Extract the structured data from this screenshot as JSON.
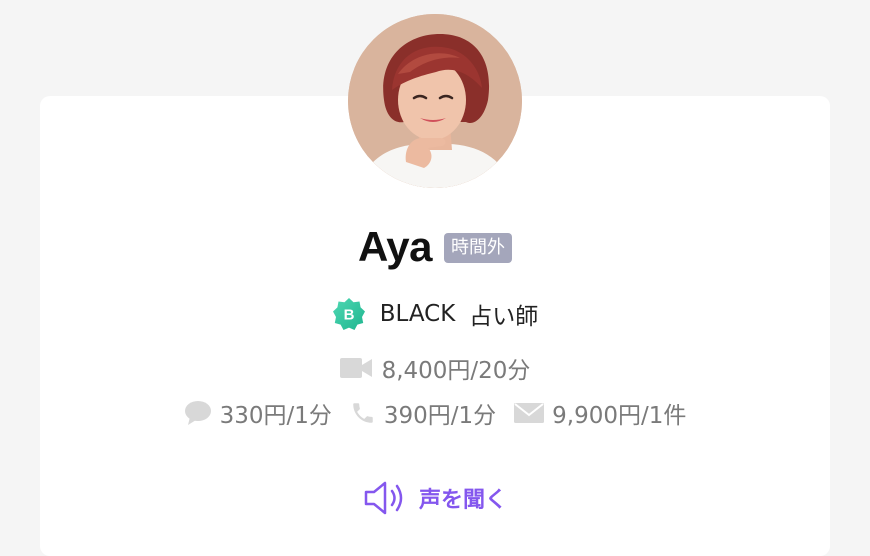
{
  "profile": {
    "name": "Aya",
    "status_badge": "時間外",
    "rank_letter": "B",
    "rank_label": "BLACK",
    "role_label": "占い師"
  },
  "prices": {
    "video": "8,400円/20分",
    "chat": "330円/1分",
    "phone": "390円/1分",
    "mail": "9,900円/1件"
  },
  "voice": {
    "label": "声を聞く"
  },
  "icons": {
    "rank": "rank-badge-icon",
    "video": "video-camera-icon",
    "chat": "chat-bubble-icon",
    "phone": "phone-icon",
    "mail": "mail-icon",
    "voice": "speaker-icon"
  },
  "colors": {
    "accent": "#8457ee",
    "status_badge_bg": "#a4a6bb",
    "rank_badge": "#2fc9a3",
    "icon_gray": "#d8d8d8",
    "price_text": "#7a7a7a"
  }
}
